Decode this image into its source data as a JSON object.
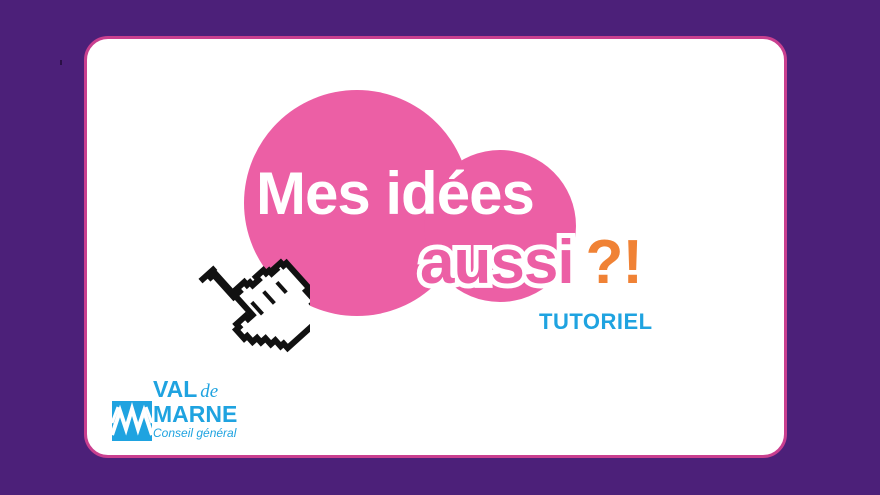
{
  "colors": {
    "background": "#4c2079",
    "card_bg": "#ffffff",
    "card_border": "#c93f8f",
    "pink": "#ec5fa5",
    "orange": "#f08235",
    "blue": "#1fa3e0"
  },
  "title": {
    "line1": "Mes idées",
    "line2_word": "aussi",
    "line2_punct": "?!"
  },
  "subtitle": "TUTORIEL",
  "cursor_icon": "pointing-hand-cursor-icon",
  "logo": {
    "line1": "VAL",
    "line1_small": "de",
    "line2": "MARNE",
    "tagline": "Conseil général"
  }
}
